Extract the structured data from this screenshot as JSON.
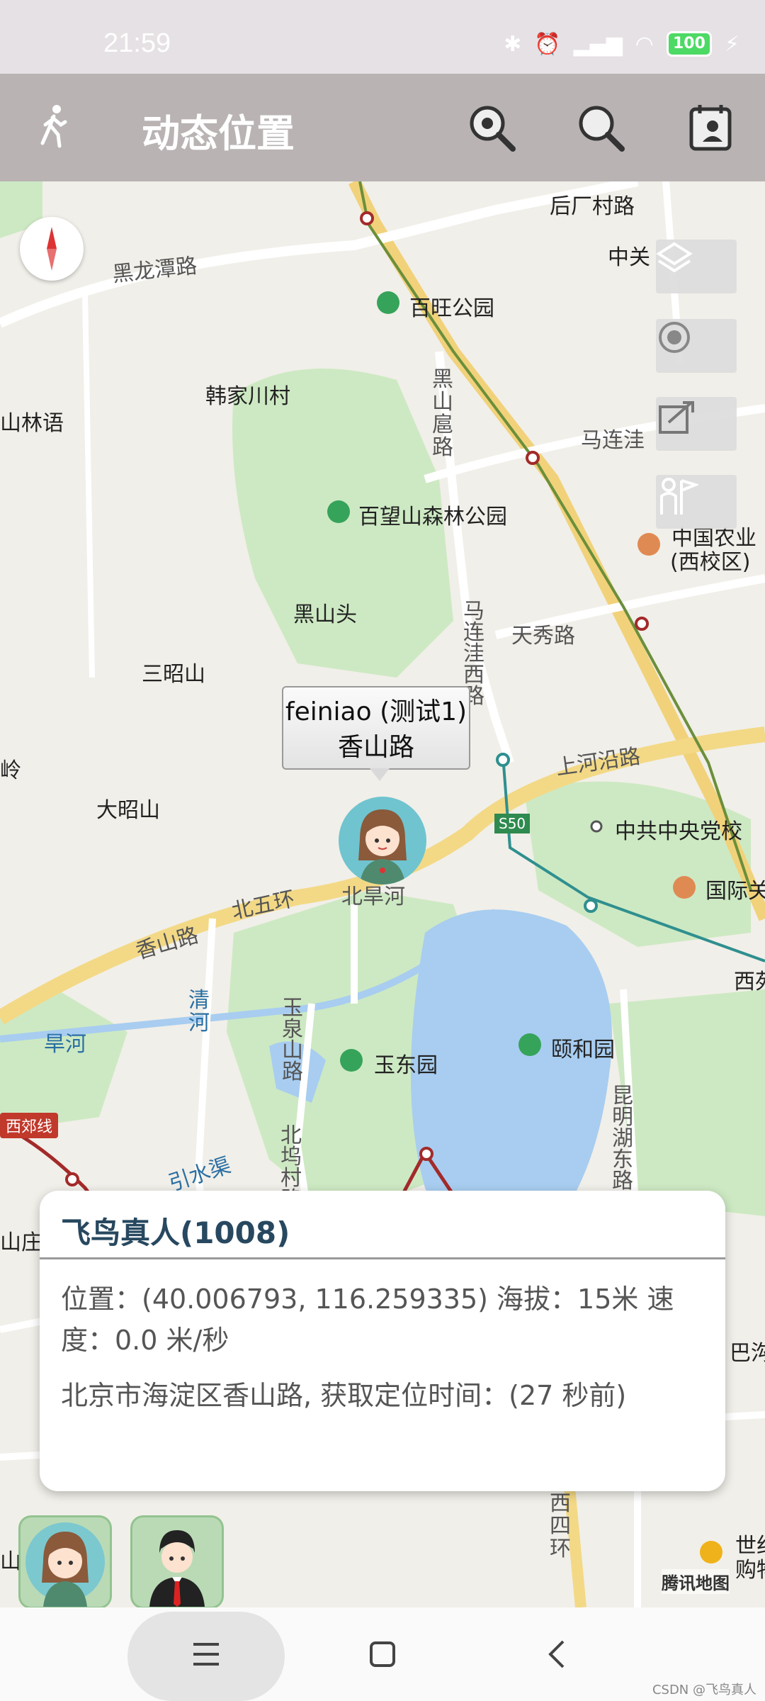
{
  "status_bar": {
    "time": "21:59",
    "battery": "100"
  },
  "app_bar": {
    "title": "动态位置",
    "icons": [
      "walk-icon",
      "zoom-locate-icon",
      "search-icon",
      "calendar-contact-icon"
    ]
  },
  "map": {
    "labels": [
      "后厂村路",
      "中关",
      "黑龙潭路",
      "百旺公园",
      "韩家川村",
      "山林语",
      "黑山扈路",
      "马连洼",
      "百望山森林公园",
      "中国农业",
      "(西校区)",
      "黑山头",
      "马连洼西路",
      "天秀路",
      "三昭山",
      "岭",
      "大昭山",
      "上河沿路",
      "S50",
      "中共中央党校",
      "北五环",
      "北旱河",
      "国际关",
      "香山路",
      "西苑",
      "清河",
      "旱河",
      "玉泉山路",
      "玉东园",
      "颐和园",
      "昆明湖东路",
      "西郊线",
      "北坞村路",
      "引水渠",
      "山庄",
      "巴沟",
      "西四环",
      "世纪",
      "购物",
      "腾讯地图",
      "山"
    ],
    "callout": {
      "line1": "feiniao (测试1)",
      "line2": "香山路"
    }
  },
  "info_card": {
    "title": "飞鸟真人(1008)",
    "position_line": "位置：(40.006793, 116.259335) 海拔：15米 速度：0.0 米/秒",
    "address_line": "北京市海淀区香山路, 获取定位时间：(27 秒前)"
  },
  "footer": {
    "watermark": "CSDN @飞鸟真人"
  }
}
